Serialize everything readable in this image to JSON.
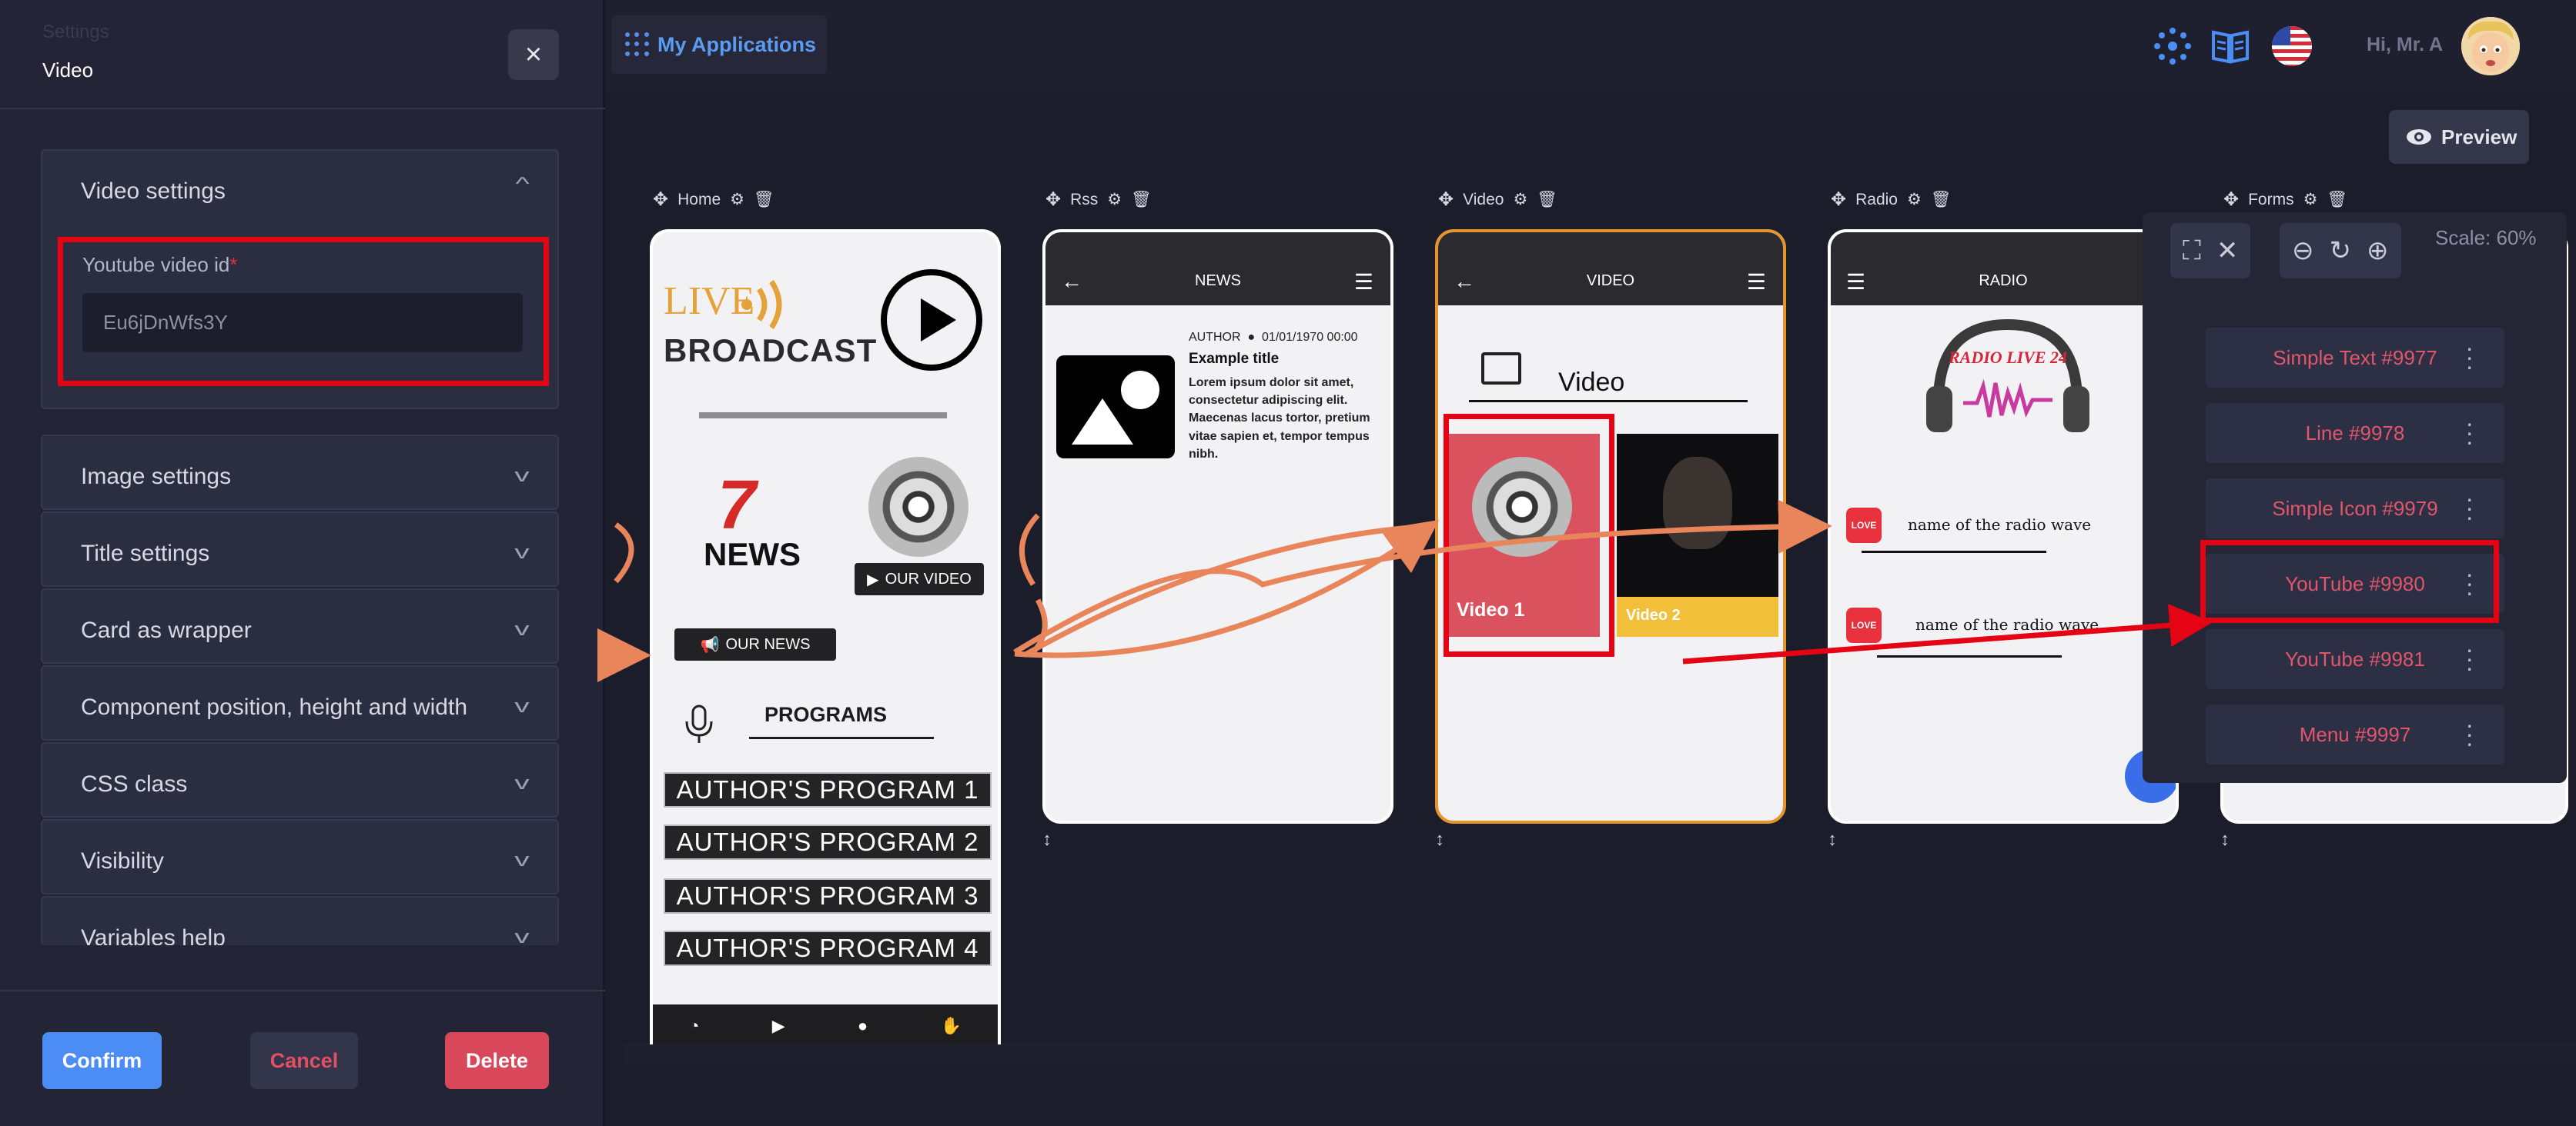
{
  "left_panel": {
    "ghost_title": "Settings",
    "subtitle": "Video",
    "close_label": "×",
    "sections": [
      {
        "label": "Video settings",
        "expanded": true
      },
      {
        "label": "Image settings",
        "expanded": false
      },
      {
        "label": "Title settings",
        "expanded": false
      },
      {
        "label": "Card as wrapper",
        "expanded": false
      },
      {
        "label": "Component position, height and width",
        "expanded": false
      },
      {
        "label": "CSS class",
        "expanded": false
      },
      {
        "label": "Visibility",
        "expanded": false
      },
      {
        "label": "Variables help",
        "expanded": false
      }
    ],
    "field": {
      "label": "Youtube video id",
      "required_mark": "*",
      "value": "Eu6jDnWfs3Y"
    },
    "buttons": {
      "confirm": "Confirm",
      "cancel": "Cancel",
      "delete": "Delete"
    }
  },
  "topbar": {
    "app_title": "My Applications",
    "greeting": "Hi, Mr. A",
    "preview_label": "Preview"
  },
  "pages": [
    {
      "name": "Home"
    },
    {
      "name": "Rss"
    },
    {
      "name": "Video"
    },
    {
      "name": "Radio"
    },
    {
      "name": "Forms"
    }
  ],
  "home_phone": {
    "live": "LIVE",
    "broadcast": "BROADCAST",
    "news_brand": "NEWS",
    "our_video": "OUR VIDEO",
    "our_news": "OUR NEWS",
    "programs_title": "PROGRAMS",
    "programs": [
      "AUTHOR'S PROGRAM 1",
      "AUTHOR'S PROGRAM 2",
      "AUTHOR'S PROGRAM 3",
      "AUTHOR'S PROGRAM 4"
    ]
  },
  "rss_phone": {
    "header": "NEWS",
    "meta_author": "AUTHOR",
    "meta_date": "01/01/1970 00:00",
    "title": "Example title",
    "body": "Lorem ipsum dolor sit amet, consectetur adipiscing elit. Maecenas lacus tortor, pretium vitae sapien et, tempor tempus nibh."
  },
  "video_phone": {
    "header": "VIDEO",
    "title": "Video",
    "card1": "Video 1",
    "card2": "Video 2"
  },
  "radio_phone": {
    "header": "RADIO",
    "logo_text": "RADIO LIVE 24",
    "rows": [
      "name of the radio wave",
      "name of the radio wave"
    ],
    "badge": "LOVE"
  },
  "forms_popup": {
    "scale": "Scale: 60%",
    "items": [
      "Simple Text #9977",
      "Line #9978",
      "Simple Icon #9979",
      "YouTube #9980",
      "YouTube #9981",
      "Menu #9997"
    ]
  },
  "colors": {
    "accent": "#4c8cf5",
    "danger": "#d8485a",
    "highlight": "#e40413",
    "connector": "#e9855a",
    "selected_page": "#e6952e"
  }
}
